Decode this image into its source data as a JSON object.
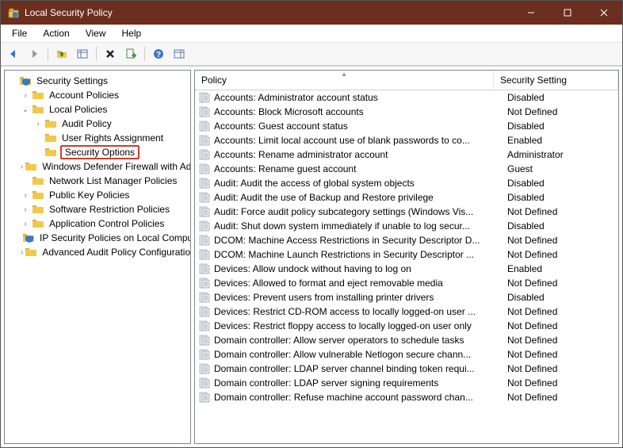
{
  "window": {
    "title": "Local Security Policy"
  },
  "menu": {
    "items": [
      "File",
      "Action",
      "View",
      "Help"
    ]
  },
  "toolbar": {
    "buttons": [
      {
        "name": "back-icon"
      },
      {
        "name": "forward-icon"
      },
      {
        "sep": true
      },
      {
        "name": "up-folder-icon"
      },
      {
        "name": "show-hide-tree-icon"
      },
      {
        "sep": true
      },
      {
        "name": "delete-icon"
      },
      {
        "name": "export-list-icon"
      },
      {
        "sep": true
      },
      {
        "name": "help-icon"
      },
      {
        "name": "show-hide-action-pane-icon"
      }
    ]
  },
  "tree": {
    "root": {
      "label": "Security Settings",
      "icon": "shield"
    },
    "nodes": [
      {
        "label": "Account Policies",
        "indent": 1,
        "expander": ">",
        "icon": "folder"
      },
      {
        "label": "Local Policies",
        "indent": 1,
        "expander": "v",
        "icon": "folder"
      },
      {
        "label": "Audit Policy",
        "indent": 2,
        "expander": ">",
        "icon": "folder"
      },
      {
        "label": "User Rights Assignment",
        "indent": 2,
        "expander": "",
        "icon": "folder"
      },
      {
        "label": "Security Options",
        "indent": 2,
        "expander": "",
        "icon": "folder",
        "selected": true
      },
      {
        "label": "Windows Defender Firewall with Advanced Security",
        "indent": 1,
        "expander": ">",
        "icon": "folder"
      },
      {
        "label": "Network List Manager Policies",
        "indent": 1,
        "expander": "",
        "icon": "folder"
      },
      {
        "label": "Public Key Policies",
        "indent": 1,
        "expander": ">",
        "icon": "folder"
      },
      {
        "label": "Software Restriction Policies",
        "indent": 1,
        "expander": ">",
        "icon": "folder"
      },
      {
        "label": "Application Control Policies",
        "indent": 1,
        "expander": ">",
        "icon": "folder"
      },
      {
        "label": "IP Security Policies on Local Computer",
        "indent": 1,
        "expander": "",
        "icon": "shield"
      },
      {
        "label": "Advanced Audit Policy Configuration",
        "indent": 1,
        "expander": ">",
        "icon": "folder"
      }
    ]
  },
  "list": {
    "columns": {
      "policy": "Policy",
      "setting": "Security Setting"
    },
    "rows": [
      {
        "policy": "Accounts: Administrator account status",
        "setting": "Disabled"
      },
      {
        "policy": "Accounts: Block Microsoft accounts",
        "setting": "Not Defined"
      },
      {
        "policy": "Accounts: Guest account status",
        "setting": "Disabled"
      },
      {
        "policy": "Accounts: Limit local account use of blank passwords to co...",
        "setting": "Enabled"
      },
      {
        "policy": "Accounts: Rename administrator account",
        "setting": "Administrator"
      },
      {
        "policy": "Accounts: Rename guest account",
        "setting": "Guest"
      },
      {
        "policy": "Audit: Audit the access of global system objects",
        "setting": "Disabled"
      },
      {
        "policy": "Audit: Audit the use of Backup and Restore privilege",
        "setting": "Disabled"
      },
      {
        "policy": "Audit: Force audit policy subcategory settings (Windows Vis...",
        "setting": "Not Defined"
      },
      {
        "policy": "Audit: Shut down system immediately if unable to log secur...",
        "setting": "Disabled"
      },
      {
        "policy": "DCOM: Machine Access Restrictions in Security Descriptor D...",
        "setting": "Not Defined"
      },
      {
        "policy": "DCOM: Machine Launch Restrictions in Security Descriptor ...",
        "setting": "Not Defined"
      },
      {
        "policy": "Devices: Allow undock without having to log on",
        "setting": "Enabled"
      },
      {
        "policy": "Devices: Allowed to format and eject removable media",
        "setting": "Not Defined"
      },
      {
        "policy": "Devices: Prevent users from installing printer drivers",
        "setting": "Disabled"
      },
      {
        "policy": "Devices: Restrict CD-ROM access to locally logged-on user ...",
        "setting": "Not Defined"
      },
      {
        "policy": "Devices: Restrict floppy access to locally logged-on user only",
        "setting": "Not Defined"
      },
      {
        "policy": "Domain controller: Allow server operators to schedule tasks",
        "setting": "Not Defined"
      },
      {
        "policy": "Domain controller: Allow vulnerable Netlogon secure chann...",
        "setting": "Not Defined"
      },
      {
        "policy": "Domain controller: LDAP server channel binding token requi...",
        "setting": "Not Defined"
      },
      {
        "policy": "Domain controller: LDAP server signing requirements",
        "setting": "Not Defined"
      },
      {
        "policy": "Domain controller: Refuse machine account password chan...",
        "setting": "Not Defined"
      }
    ]
  }
}
